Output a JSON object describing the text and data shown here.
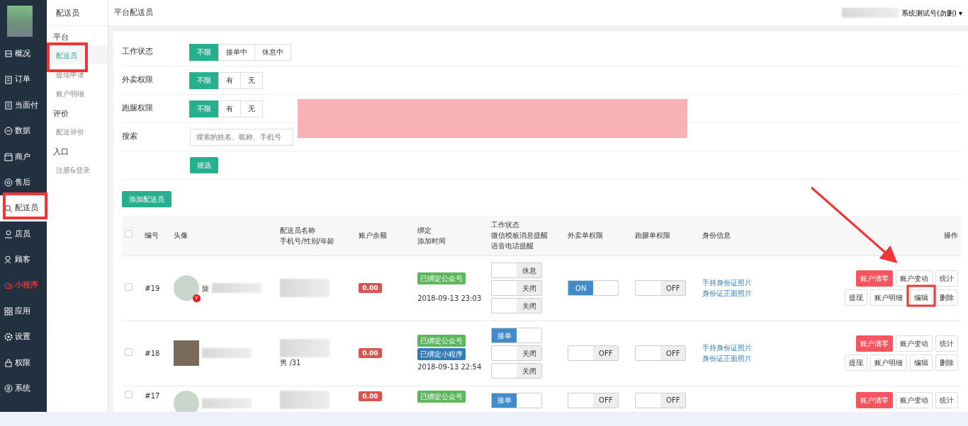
{
  "sidebar": {
    "items": [
      {
        "label": "概况",
        "selected": false,
        "highlighted": false
      },
      {
        "label": "订单",
        "selected": false,
        "highlighted": false
      },
      {
        "label": "当面付",
        "selected": false,
        "highlighted": false
      },
      {
        "label": "数据",
        "selected": false,
        "highlighted": false
      },
      {
        "label": "商户",
        "selected": false,
        "highlighted": false
      },
      {
        "label": "售后",
        "selected": false,
        "highlighted": false
      },
      {
        "label": "配送员",
        "selected": true,
        "highlighted": false
      },
      {
        "label": "店员",
        "selected": false,
        "highlighted": false
      },
      {
        "label": "顾客",
        "selected": false,
        "highlighted": false
      },
      {
        "label": "小程序",
        "selected": false,
        "highlighted": true
      },
      {
        "label": "应用",
        "selected": false,
        "highlighted": false
      },
      {
        "label": "设置",
        "selected": false,
        "highlighted": false
      },
      {
        "label": "权限",
        "selected": false,
        "highlighted": false
      },
      {
        "label": "系统",
        "selected": false,
        "highlighted": false
      }
    ]
  },
  "submenu": {
    "title": "配送员",
    "groups": [
      {
        "title": "平台",
        "items": [
          {
            "label": "配送员",
            "selected": true
          },
          {
            "label": "提现申请",
            "selected": false
          },
          {
            "label": "账户明细",
            "selected": false
          }
        ]
      },
      {
        "title": "评价",
        "items": [
          {
            "label": "配送评价",
            "selected": false
          }
        ]
      },
      {
        "title": "入口",
        "items": [
          {
            "label": "注册&登录",
            "selected": false
          }
        ]
      }
    ]
  },
  "header": {
    "title": "平台配送员",
    "user": "系统测试号(勿删)",
    "caret": "▾"
  },
  "filters": [
    {
      "label": "工作状态",
      "options": [
        {
          "label": "不限",
          "selected": true
        },
        {
          "label": "接单中",
          "selected": false
        },
        {
          "label": "休息中",
          "selected": false
        }
      ]
    },
    {
      "label": "外卖权限",
      "options": [
        {
          "label": "不限",
          "selected": true
        },
        {
          "label": "有",
          "selected": false
        },
        {
          "label": "无",
          "selected": false
        }
      ]
    },
    {
      "label": "跑腿权限",
      "options": [
        {
          "label": "不限",
          "selected": true
        },
        {
          "label": "有",
          "selected": false
        },
        {
          "label": "无",
          "selected": false
        }
      ]
    }
  ],
  "search": {
    "label": "搜索",
    "placeholder": "搜索的姓名、昵称、手机号"
  },
  "filter_button": "筛选",
  "add_button": "添加配送员",
  "table": {
    "all_checked": false,
    "columns": [
      {
        "lines": [
          "编号"
        ]
      },
      {
        "lines": [
          "头像"
        ]
      },
      {
        "lines": [
          "配送员名称",
          "手机号/性别/年龄"
        ]
      },
      {
        "lines": [
          "账户余额"
        ]
      },
      {
        "lines": [
          "绑定",
          "添加时间"
        ]
      },
      {
        "lines": [
          "工作状态",
          "微信模板消息提醒",
          "语音电话提醒"
        ]
      },
      {
        "lines": [
          "外卖单权限"
        ]
      },
      {
        "lines": [
          "跑腿单权限"
        ]
      },
      {
        "lines": [
          "身份信息"
        ]
      },
      {
        "lines": [
          "操作"
        ]
      }
    ],
    "rows": [
      {
        "checked": false,
        "number": "#19",
        "avatar_badge": "V",
        "name": "旋",
        "gender_age": "",
        "balance": "0.00",
        "bindings": [
          {
            "label": "已绑定公众号",
            "kind": "official"
          }
        ],
        "added": "2018-09-13 23:03",
        "switches": [
          {
            "label": "休息",
            "on": false
          },
          {
            "label": "关闭",
            "on": false
          },
          {
            "label": "关闭",
            "on": false
          }
        ],
        "takeout": {
          "label": "ON",
          "on": true
        },
        "errand": {
          "label": "OFF",
          "on": false
        },
        "id_links": [
          "手持身份证照片",
          "身份证正面照片"
        ],
        "actions": [
          [
            {
              "label": "账户清零",
              "kind": "danger"
            },
            {
              "label": "账户变动",
              "kind": "plain"
            },
            {
              "label": "统计",
              "kind": "plain"
            }
          ],
          [
            {
              "label": "提现",
              "kind": "plain"
            },
            {
              "label": "账户明细",
              "kind": "plain"
            },
            {
              "label": "编辑",
              "kind": "plain"
            },
            {
              "label": "删除",
              "kind": "plain"
            }
          ]
        ]
      },
      {
        "checked": false,
        "number": "#18",
        "avatar_badge": "",
        "name": "",
        "gender_age": "男 /31",
        "balance": "0.00",
        "bindings": [
          {
            "label": "已绑定公众号",
            "kind": "official"
          },
          {
            "label": "已绑定小程序",
            "kind": "mini"
          }
        ],
        "added": "2018-09-13 22:54",
        "switches": [
          {
            "label": "接单",
            "on": true
          },
          {
            "label": "关闭",
            "on": false
          },
          {
            "label": "关闭",
            "on": false
          }
        ],
        "takeout": {
          "label": "OFF",
          "on": false
        },
        "errand": {
          "label": "OFF",
          "on": false
        },
        "id_links": [
          "手持身份证照片",
          "身份证正面照片"
        ],
        "actions": [
          [
            {
              "label": "账户清零",
              "kind": "danger"
            },
            {
              "label": "账户变动",
              "kind": "plain"
            },
            {
              "label": "统计",
              "kind": "plain"
            }
          ],
          [
            {
              "label": "提现",
              "kind": "plain"
            },
            {
              "label": "账户明细",
              "kind": "plain"
            },
            {
              "label": "编辑",
              "kind": "plain"
            },
            {
              "label": "删除",
              "kind": "plain"
            }
          ]
        ]
      },
      {
        "checked": false,
        "number": "#17",
        "avatar_badge": "",
        "name": "",
        "gender_age": "",
        "balance": "0.00",
        "bindings": [
          {
            "label": "已绑定公众号",
            "kind": "official"
          }
        ],
        "added": "",
        "switches": [
          {
            "label": "接单",
            "on": true
          }
        ],
        "takeout": {
          "label": "OFF",
          "on": false
        },
        "errand": {
          "label": "OFF",
          "on": false
        },
        "id_links": [],
        "actions": [
          [
            {
              "label": "账户清零",
              "kind": "danger"
            },
            {
              "label": "账户变动",
              "kind": "plain"
            },
            {
              "label": "统计",
              "kind": "plain"
            }
          ]
        ]
      }
    ]
  }
}
